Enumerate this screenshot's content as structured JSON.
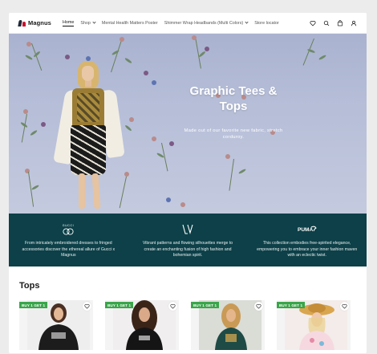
{
  "header": {
    "logo_text": "Magnus",
    "nav": [
      {
        "label": "Home",
        "active": true,
        "has_dropdown": false
      },
      {
        "label": "Shop",
        "active": false,
        "has_dropdown": true
      },
      {
        "label": "Mental Health Matters Poster",
        "active": false,
        "has_dropdown": false
      },
      {
        "label": "Shimmer Wrap Headbands (Multi Colors)",
        "active": false,
        "has_dropdown": true
      },
      {
        "label": "Store locator",
        "active": false,
        "has_dropdown": false
      }
    ],
    "icons": [
      "heart-icon",
      "search-icon",
      "bag-icon",
      "user-icon"
    ]
  },
  "hero": {
    "title": "Graphic Tees & Tops",
    "subtitle": "Made out of our favorite new fabric, stretch corduroy."
  },
  "brands": [
    {
      "name": "GUCCI",
      "text": "From intricately embroidered dresses to fringed accessories discover the ethereal allure of Gucci x Magnus"
    },
    {
      "name": "LV",
      "text": "Vibrant patterns and flowing silhouettes merge to create an enchanting fusion of high fashion and bohemian spirit."
    },
    {
      "name": "PUMA",
      "text": "This collection embodies free-spirited elegance, empowering you to embrace your inner fashion maven with an eclectic twist."
    }
  ],
  "tops": {
    "title": "Tops",
    "products": [
      {
        "badge": "BUY 1 GET 1"
      },
      {
        "badge": "BUY 1 GET 1"
      },
      {
        "badge": "BUY 1 GET 1"
      },
      {
        "badge": "BUY 1 GET 1"
      }
    ]
  },
  "colors": {
    "band": "#0d4048",
    "badge": "#3aa54a",
    "hero_bg": "#b6bed8"
  }
}
